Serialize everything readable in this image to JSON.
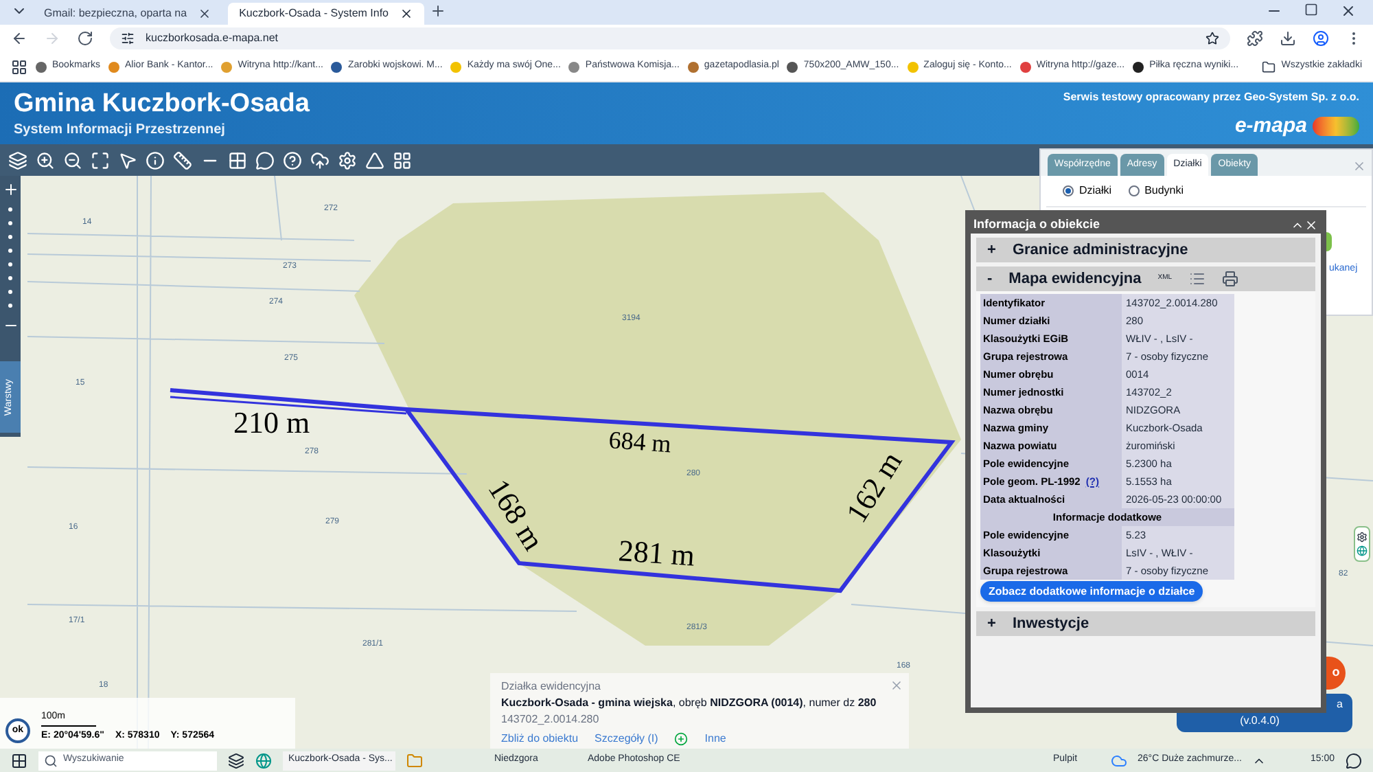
{
  "browser": {
    "tabs": [
      {
        "title": "Gmail: bezpieczna, oparta na",
        "selected": false
      },
      {
        "title": "Kuczbork-Osada - System Info",
        "selected": true
      }
    ],
    "url": "kuczborkosada.e-mapa.net",
    "bookmarks": [
      "Bookmarks",
      "Alior Bank - Kantor...",
      "Witryna http://kant...",
      "Zarobki wojskowi. M...",
      "Każdy ma swój One...",
      "Państwowa Komisja...",
      "gazetapodlasia.pl",
      "750x200_AMW_150...",
      "Zaloguj się - Konto...",
      "Witryna http://gaze...",
      "Piłka ręczna wyniki..."
    ],
    "all_bookmarks": "Wszystkie zakładki"
  },
  "header": {
    "title": "Gmina Kuczbork-Osada",
    "subtitle": "System Informacji Przestrzennej",
    "credit": "Serwis testowy opracowany przez Geo-System Sp. z o.o.",
    "logo": "e-mapa"
  },
  "side_tab": "Warstwy",
  "search_panel": {
    "tabs": [
      {
        "label": "Współrzędne",
        "selected": false
      },
      {
        "label": "Adresy",
        "selected": false
      },
      {
        "label": "Działki",
        "selected": true
      },
      {
        "label": "Obiekty",
        "selected": false
      }
    ],
    "radios": [
      {
        "label": "Działki",
        "selected": true
      },
      {
        "label": "Budynki",
        "selected": false
      }
    ],
    "link_fragment": "ukanej"
  },
  "map": {
    "parcel_labels": [
      "272",
      "273",
      "274",
      "275",
      "3194",
      "278",
      "280",
      "279",
      "14",
      "15",
      "16",
      "17/1",
      "281/1",
      "281/3",
      "168",
      "18",
      "82"
    ],
    "measurements": [
      "210 m",
      "684 m",
      "168 m",
      "281 m",
      "162 m"
    ],
    "scale": "100m",
    "coordinates": [
      "E: 20°04'59.6\"",
      "X: 578310",
      "Y: 572564"
    ],
    "ok_button": "ok"
  },
  "info_panel": {
    "title": "Informacja o obiekcie",
    "sections": [
      {
        "sign": "+",
        "title": "Granice administracyjne"
      },
      {
        "sign": "-",
        "title": "Mapa ewidencyjna",
        "xml": "XML",
        "rows": [
          {
            "label": "Identyfikator",
            "value": "143702_2.0014.280"
          },
          {
            "label": "Numer działki",
            "value": "280"
          },
          {
            "label": "Klasoużytki EGiB",
            "value": "WŁIV - , LsIV -"
          },
          {
            "label": "Grupa rejestrowa",
            "value": "7 - osoby fizyczne"
          },
          {
            "label": "Numer obrębu",
            "value": "0014"
          },
          {
            "label": "Numer jednostki",
            "value": "143702_2"
          },
          {
            "label": "Nazwa obrębu",
            "value": "NIDZGORA"
          },
          {
            "label": "Nazwa gminy",
            "value": "Kuczbork-Osada"
          },
          {
            "label": "Nazwa powiatu",
            "value": "żuromiński"
          },
          {
            "label": "Pole ewidencyjne",
            "value": "5.2300 ha"
          },
          {
            "label": "Pole geom. PL-1992",
            "link": "(?)",
            "value": "5.1553 ha"
          },
          {
            "label": "Data aktualności",
            "value": "2026-05-23 00:00:00"
          }
        ],
        "subheading": "Informacje dodatkowe",
        "extra_rows": [
          {
            "label": "Pole ewidencyjne",
            "value": "5.23"
          },
          {
            "label": "Klasoużytki",
            "value": "LsIV - , WŁIV -"
          },
          {
            "label": "Grupa rejestrowa",
            "value": "7 - osoby fizyczne"
          }
        ],
        "button": "Zobacz dodatkowe informacje o działce"
      },
      {
        "sign": "+",
        "title": "Inwestycje"
      }
    ]
  },
  "popup": {
    "heading": "Działka ewidencyjna",
    "line": "**Kuczbork-Osada - gmina wiejska**, obręb **NIDZGORA (0014)**, numer dz **280**",
    "id": "143702_2.0014.280",
    "links": [
      "Zbliż do obiektu",
      "Szczegóły (I)",
      "Inne"
    ]
  },
  "orange_badge": "o",
  "version_button": {
    "fragment": "a",
    "version": "(v.0.4.0)"
  },
  "taskbar": {
    "search": "Wyszukiwanie",
    "windows": [
      "Kuczbork-Osada - Sys...",
      "Niedzgora",
      "Adobe Photoshop CE"
    ],
    "desktop": "Pulpit",
    "weather": "26°C  Duże zachmurze...",
    "time": "15:00"
  }
}
